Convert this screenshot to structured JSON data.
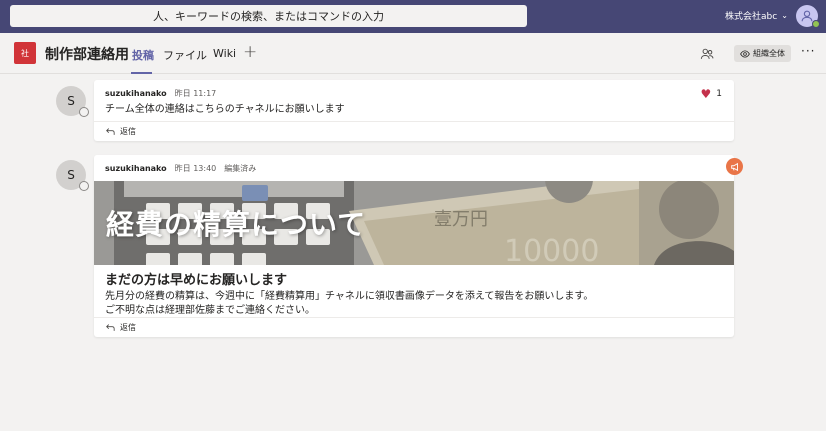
{
  "topbar": {
    "search_placeholder": "人、キーワードの検索、またはコマンドの入力",
    "org_name": "株式会社abc",
    "org_chevron": "⌄"
  },
  "channel": {
    "team_icon_text": "社",
    "title": "制作部連絡用",
    "tabs": [
      {
        "label": "投稿",
        "active": true
      },
      {
        "label": "ファイル",
        "active": false
      },
      {
        "label": "Wiki",
        "active": false
      }
    ],
    "add_tab": "+",
    "org_wide_label": "組織全体",
    "more": "···"
  },
  "posts": [
    {
      "avatar_initial": "S",
      "author": "suzukihanako",
      "time": "昨日 11:17",
      "text": "チーム全体の連絡はこちらのチャネルにお願いします",
      "like_count": "1",
      "reply_label": "返信"
    },
    {
      "avatar_initial": "S",
      "author": "suzukihanako",
      "time": "昨日 13:40",
      "edited": "編集済み",
      "banner_title": "経費の精算について",
      "heading": "まだの方は早めにお願いします",
      "lines": [
        "先月分の経費の精算は、今週中に「経費精算用」チャネルに領収書画像データを添えて報告をお願いします。",
        "ご不明な点は経理部佐藤までご連絡ください。"
      ],
      "reply_label": "返信"
    }
  ],
  "colors": {
    "brand": "#464775",
    "accent": "#6264a7",
    "team_icon": "#d13438",
    "announcement": "#e97548",
    "like": "#c4314b"
  }
}
